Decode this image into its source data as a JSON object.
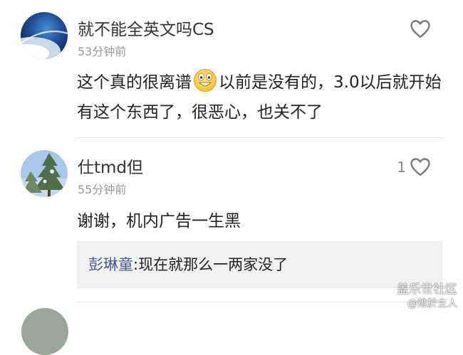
{
  "comments": [
    {
      "username": "就不能全英文吗CS",
      "timestamp": "53分钟前",
      "like_count": "",
      "avatar_icon": "earth-orbit-avatar-icon",
      "text_part1": "这个真的很离谱",
      "emoji": "grinning-face-emoji",
      "text_part2": "以前是没有的，3.0以后就开始有这个东西了，很恶心，也关不了"
    },
    {
      "username": "仕tmd但",
      "timestamp": "55分钟前",
      "like_count": "1",
      "avatar_icon": "pine-tree-avatar-icon",
      "text": "谢谢，机内广告一生黑",
      "reply": {
        "author": "彭琳童",
        "separator": ":",
        "text": "现在就那么一两家没了"
      }
    }
  ],
  "watermark": {
    "name": "盖乐世社区",
    "handle": "@雉於主人"
  },
  "colors": {
    "reply_author": "#4a5a8c",
    "timestamp": "#999999",
    "reply_bg": "#f1f1f1",
    "heart_stroke": "#7a7a7a"
  }
}
